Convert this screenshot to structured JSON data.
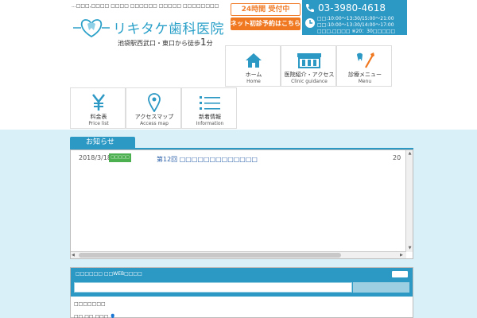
{
  "header": {
    "tagline": "...□□□,□□□□ □□□□ □□□□□□ □□□□□ □□□□□□□□",
    "logo_name": "リキタケ歯科医院",
    "logo_sub": "池袋駅西武口・東口から徒歩",
    "logo_minutes": "1",
    "logo_unit": "分",
    "reserve_top": "24時間 受付中",
    "reserve_bottom": "ネット初診予約はこちら",
    "tel": "03-3980-4618",
    "hours_line1": "□□:10:00～13:30/15:00～21:00",
    "hours_line2": "□□:10:00～13:30/14:00～17:00",
    "hours_line3": "□□□,□□□□ ※20：30□□□□□"
  },
  "nav": [
    {
      "jp": "ホーム",
      "en": "Home",
      "icon": "house-icon"
    },
    {
      "jp": "医院紹介・アクセス",
      "en": "Clinic guidance",
      "icon": "clinic-icon"
    },
    {
      "jp": "診療メニュー",
      "en": "Menu",
      "icon": "toothbrush-icon"
    },
    {
      "jp": "料金表",
      "en": "Price list",
      "icon": "yen-icon"
    },
    {
      "jp": "アクセスマップ",
      "en": "Access map",
      "icon": "map-pin-icon"
    },
    {
      "jp": "新着情報",
      "en": "Information",
      "icon": "list-icon"
    }
  ],
  "notice": {
    "tab_label": "お知らせ",
    "date": "2018/3/18",
    "badge": "□□□□□",
    "title": "第12回 □□□□□□□□□□□□□",
    "counter": "20"
  },
  "web": {
    "header": "□□□□□□ □□WEB□□□□",
    "label": "□□□□□□□",
    "row": "□□ □□ □□□ 👤"
  },
  "colors": {
    "primary": "#2c98c4",
    "accent": "#f07820",
    "background": "#daf0f8",
    "badge": "#4caf50"
  }
}
